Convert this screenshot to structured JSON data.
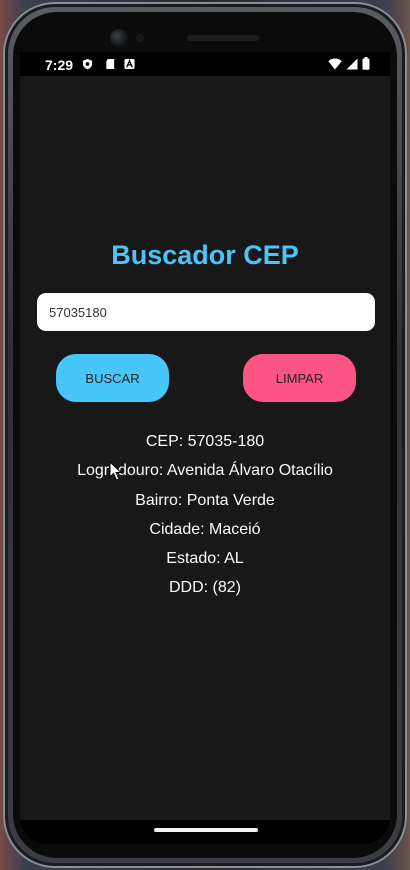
{
  "status_bar": {
    "time": "7:29",
    "icons_left": [
      "shield-icon",
      "sd-card-icon",
      "a-notification-icon"
    ],
    "icons_right": [
      "wifi-icon",
      "signal-icon",
      "battery-icon"
    ]
  },
  "app": {
    "title": "Buscador CEP",
    "cep_input": {
      "value": "57035180",
      "placeholder": ""
    },
    "buttons": {
      "search_label": "BUSCAR",
      "clear_label": "LIMPAR"
    },
    "results": [
      "CEP: 57035-180",
      "Logradouro: Avenida Álvaro Otacílio",
      "Bairro: Ponta Verde",
      "Cidade: Maceió",
      "Estado: AL",
      "DDD: (82)"
    ]
  },
  "colors": {
    "background": "#181818",
    "title": "#4ec3f7",
    "search_button": "#47c6fa",
    "clear_button": "#fd5486",
    "text": "#fafafa"
  }
}
